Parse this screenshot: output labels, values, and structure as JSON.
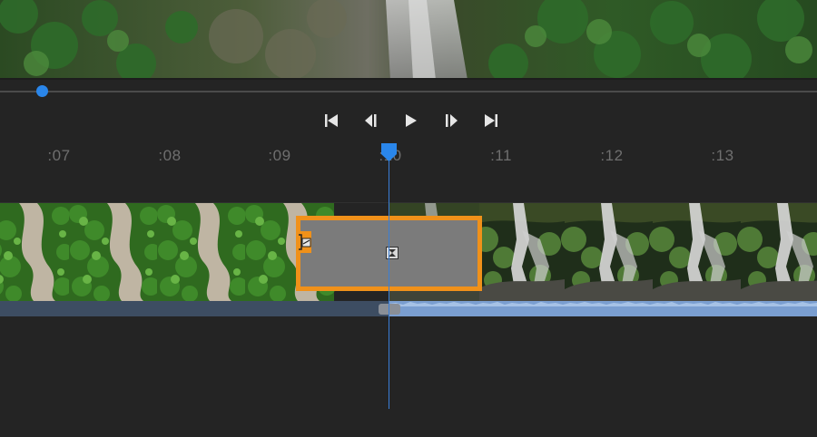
{
  "preview": {
    "image": "aerial-waterfall-forest-frame"
  },
  "scrubber": {
    "position_fraction": 0.052
  },
  "transport": {
    "buttons": [
      {
        "name": "go-to-start",
        "icon": "skip-to-start-icon"
      },
      {
        "name": "step-back",
        "icon": "step-back-icon"
      },
      {
        "name": "play",
        "icon": "play-icon"
      },
      {
        "name": "step-forward",
        "icon": "step-forward-icon"
      },
      {
        "name": "go-to-end",
        "icon": "skip-to-end-icon"
      }
    ]
  },
  "ruler": {
    "labels": [
      ":07",
      ":08",
      ":09",
      ":10",
      ":11",
      ":12",
      ":13"
    ]
  },
  "track": {
    "clips": [
      {
        "name": "aerial-river-forest",
        "thumbnail": "aerial-forest-river-icon"
      },
      {
        "name": "gap-clip",
        "selected": true,
        "icon": "gap-icon"
      },
      {
        "name": "waterfall-rocks",
        "thumbnail": "waterfall-icon"
      }
    ]
  },
  "colors": {
    "accent": "#2a86ea",
    "selection": "#f0911a",
    "audio_muted": "#3d4d62",
    "audio_active": "#7a9ed0",
    "background": "#242424"
  }
}
